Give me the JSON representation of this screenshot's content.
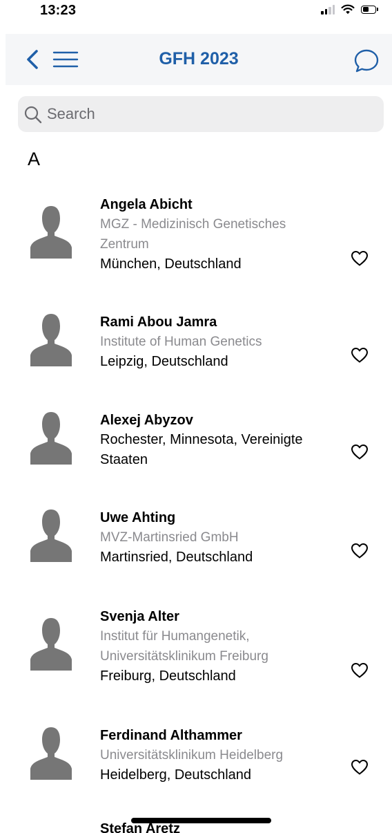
{
  "status_bar": {
    "time": "13:23"
  },
  "nav": {
    "title": "GFH 2023",
    "accent_color": "#1f5fa8",
    "left_icons": [
      "chevron-left-icon",
      "hamburger-menu-icon"
    ],
    "right_icon": "chat-bubble-icon"
  },
  "search": {
    "placeholder": "Search",
    "value": ""
  },
  "section": {
    "header": "A"
  },
  "people": [
    {
      "name": "Angela Abicht",
      "org": "MGZ - Medizinisch Genetisches Zentrum",
      "location": "München, Deutschland",
      "favorite": false
    },
    {
      "name": "Rami Abou Jamra",
      "org": "Institute of Human Genetics",
      "location": "Leipzig, Deutschland",
      "favorite": false
    },
    {
      "name": "Alexej Abyzov",
      "org": "",
      "location": "Rochester, Minnesota, Vereinigte Staaten",
      "favorite": false
    },
    {
      "name": "Uwe Ahting",
      "org": "MVZ-Martinsried GmbH",
      "location": "Martinsried, Deutschland",
      "favorite": false
    },
    {
      "name": "Svenja Alter",
      "org": "Institut für Humangenetik, Universitätsklinikum Freiburg",
      "location": "Freiburg, Deutschland",
      "favorite": false
    },
    {
      "name": "Ferdinand Althammer",
      "org": "Universitätsklinikum Heidelberg",
      "location": "Heidelberg, Deutschland",
      "favorite": false
    }
  ],
  "peek": {
    "name": "Stefan Aretz"
  }
}
